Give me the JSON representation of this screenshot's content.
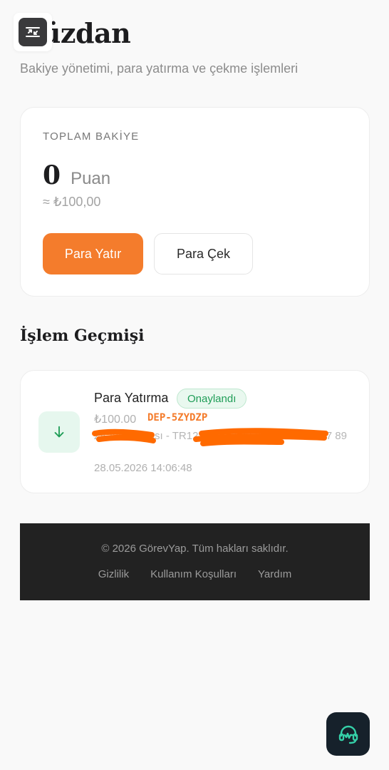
{
  "header": {
    "title": "Cüzdan",
    "subtitle": "Bakiye yönetimi, para yatırma ve çekme işlemleri"
  },
  "balance": {
    "label": "TOPLAM BAKİYE",
    "amount": "0",
    "unit": "Puan",
    "approx": "≈ ₺100,00",
    "deposit_label": "Para Yatır",
    "withdraw_label": "Para Çek"
  },
  "history": {
    "title": "İşlem Geçmişi",
    "transactions": [
      {
        "title": "Para Yatırma",
        "status": "Onaylandı",
        "amount": "₺100.00",
        "ref": "DEP-5ZYDZP",
        "detail": "Ziraat Bankası - TR12 0001 0000 0000 0123 4567 89",
        "date": "28.05.2026 14:06:48"
      }
    ]
  },
  "footer": {
    "copyright": "© 2026 GörevYap. Tüm hakları saklıdır.",
    "links": [
      "Gizlilik",
      "Kullanım Koşulları",
      "Yardım"
    ]
  },
  "colors": {
    "accent": "#f47c2c",
    "success": "#1f9d57",
    "footer_bg": "#222222",
    "fab_bg": "#16212b"
  },
  "icons": {
    "floating_toggle": "collapse-arrows-icon",
    "deposit": "arrow-down-icon",
    "support": "headset-icon"
  }
}
